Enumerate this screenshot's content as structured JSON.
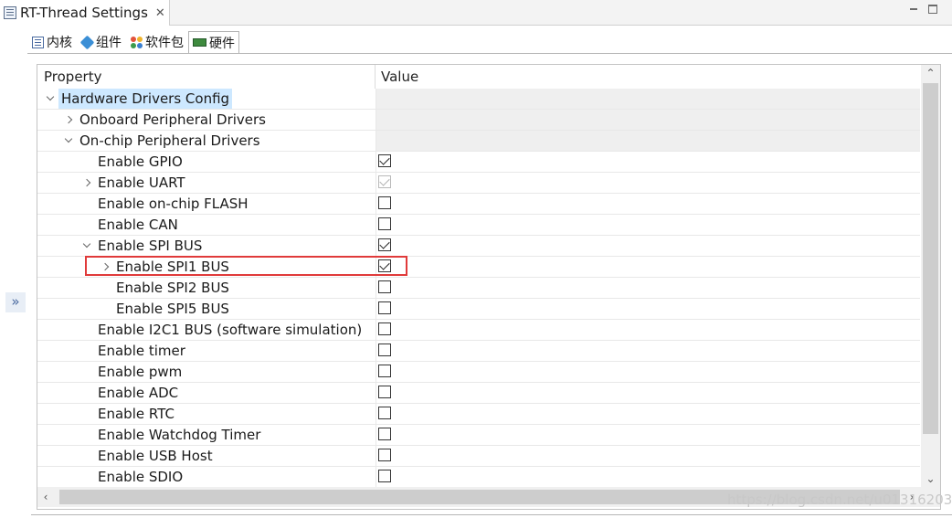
{
  "window": {
    "tab_title": "RT-Thread Settings",
    "tab_close": "✕"
  },
  "subtabs": [
    {
      "label": "内核",
      "icon": "kernel-icon"
    },
    {
      "label": "组件",
      "icon": "component-icon"
    },
    {
      "label": "软件包",
      "icon": "package-icon"
    },
    {
      "label": "硬件",
      "icon": "hardware-icon",
      "active": true
    }
  ],
  "side_handle": "»",
  "table": {
    "columns": {
      "property": "Property",
      "value": "Value"
    },
    "rows": [
      {
        "label": "Hardware Drivers Config",
        "level": 0,
        "twisty": "open",
        "type": "group",
        "selected": true
      },
      {
        "label": "Onboard Peripheral Drivers",
        "level": 1,
        "twisty": "closed",
        "type": "group"
      },
      {
        "label": "On-chip Peripheral Drivers",
        "level": 1,
        "twisty": "open",
        "type": "group"
      },
      {
        "label": "Enable GPIO",
        "level": 2,
        "twisty": "none",
        "type": "bool",
        "checked": true
      },
      {
        "label": "Enable UART",
        "level": 2,
        "twisty": "closed",
        "type": "bool",
        "checked": true,
        "disabled": true
      },
      {
        "label": "Enable on-chip FLASH",
        "level": 2,
        "twisty": "none",
        "type": "bool",
        "checked": false
      },
      {
        "label": "Enable CAN",
        "level": 2,
        "twisty": "none",
        "type": "bool",
        "checked": false
      },
      {
        "label": "Enable SPI BUS",
        "level": 2,
        "twisty": "open",
        "type": "bool",
        "checked": true
      },
      {
        "label": "Enable SPI1 BUS",
        "level": 3,
        "twisty": "closed",
        "type": "bool",
        "checked": true,
        "highlighted": true
      },
      {
        "label": "Enable SPI2 BUS",
        "level": 3,
        "twisty": "none",
        "type": "bool",
        "checked": false
      },
      {
        "label": "Enable SPI5 BUS",
        "level": 3,
        "twisty": "none",
        "type": "bool",
        "checked": false
      },
      {
        "label": "Enable I2C1 BUS (software simulation)",
        "level": 2,
        "twisty": "none",
        "type": "bool",
        "checked": false
      },
      {
        "label": "Enable timer",
        "level": 2,
        "twisty": "none",
        "type": "bool",
        "checked": false
      },
      {
        "label": "Enable pwm",
        "level": 2,
        "twisty": "none",
        "type": "bool",
        "checked": false
      },
      {
        "label": "Enable ADC",
        "level": 2,
        "twisty": "none",
        "type": "bool",
        "checked": false
      },
      {
        "label": "Enable RTC",
        "level": 2,
        "twisty": "none",
        "type": "bool",
        "checked": false
      },
      {
        "label": "Enable Watchdog Timer",
        "level": 2,
        "twisty": "none",
        "type": "bool",
        "checked": false
      },
      {
        "label": "Enable USB Host",
        "level": 2,
        "twisty": "none",
        "type": "bool",
        "checked": false
      },
      {
        "label": "Enable SDIO",
        "level": 2,
        "twisty": "none",
        "type": "bool",
        "checked": false
      }
    ]
  },
  "watermark": "https://blog.csdn.net/u013162035",
  "colors": {
    "highlight_border": "#e03a3a",
    "selection": "#cde8ff",
    "group_value_bg": "#efefef"
  }
}
